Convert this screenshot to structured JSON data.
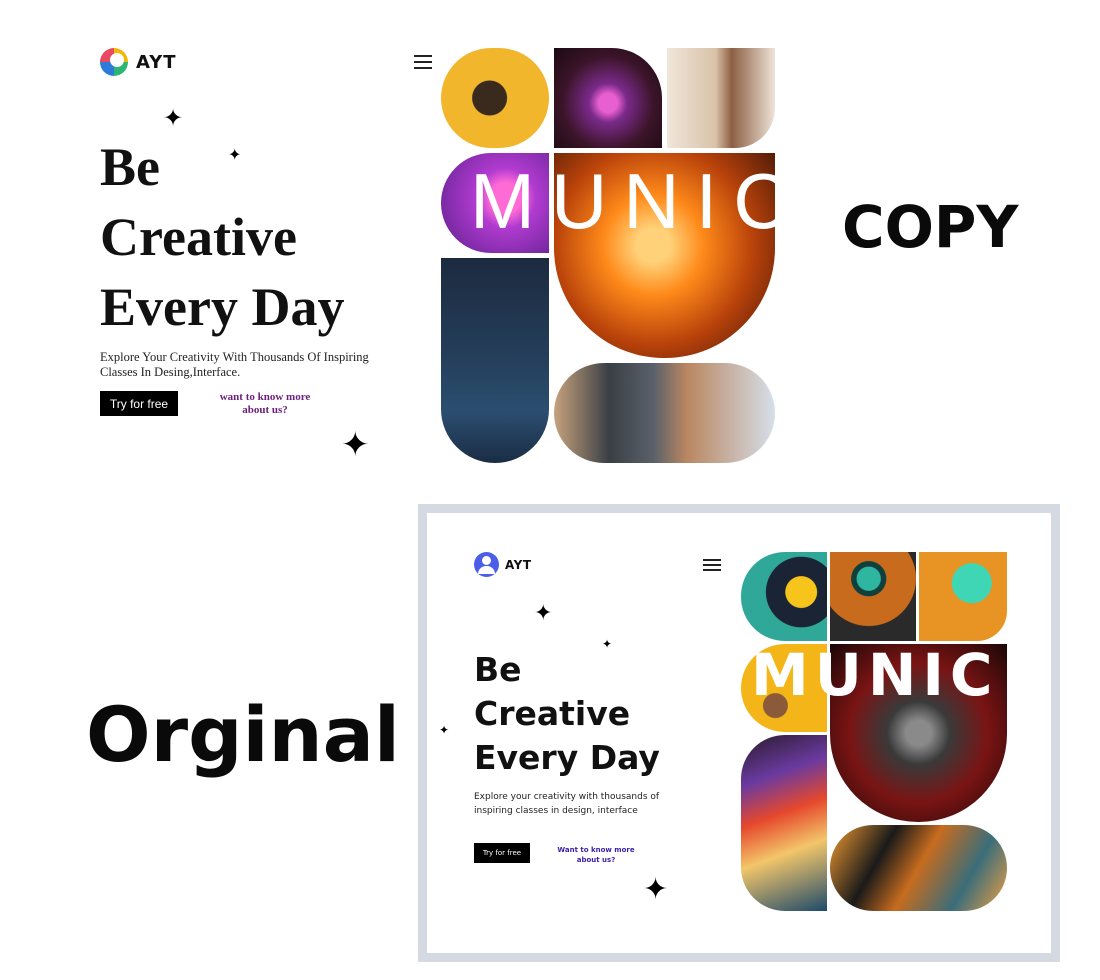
{
  "copy": {
    "label": "COPY",
    "logo_text": "AYT",
    "headline": [
      "Be",
      "Creative",
      "Every Day"
    ],
    "subtext": "Explore Your Creativity With Thousands Of Inspiring Classes In Desing,Interface.",
    "cta_button": "Try for free",
    "more_link": "want to know more about us?",
    "collage_word": "MUNIC"
  },
  "original": {
    "label": "Orginal",
    "logo_text": "AYT",
    "headline": [
      "Be",
      "Creative",
      "Every Day"
    ],
    "subtext": "Explore your creativity with thousands of inspiring classes in design, interface",
    "cta_button": "Try for free",
    "more_link": "Want to know more about us?",
    "collage_word": "MUNIC"
  },
  "icons": {
    "menu": "hamburger-icon",
    "sparkle": "sparkle-icon"
  },
  "colors": {
    "copy_link": "#6b1f7a",
    "original_link": "#3a1fa8",
    "original_logo": "#4c5ee8",
    "frame_border": "#d5d9e2"
  }
}
